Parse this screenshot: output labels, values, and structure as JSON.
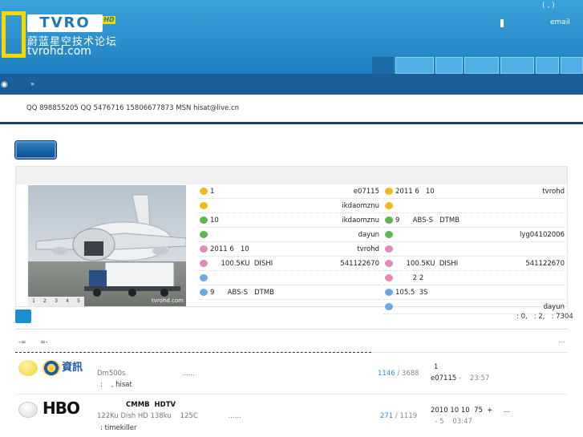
{
  "header": {
    "logo_text": "TVRO",
    "logo_badge": "HD",
    "logo_cn": "蔚蓝星空技术论坛",
    "logo_url": "tvrohd.com",
    "top_paren": "(   ,   )",
    "email_label": "email"
  },
  "subnav": {
    "bubble": "◉",
    "arrow": "»"
  },
  "contact": "QQ 898855205 QQ  5476716    15806677873 MSN hisat@live.cn",
  "panel": {
    "photo_watermark": "tvrohd.com",
    "photo_pages": [
      "1",
      "2",
      "3",
      "4",
      "5"
    ],
    "left_list": [
      {
        "icon": "yellow",
        "text": "1",
        "author": "e07115"
      },
      {
        "icon": "yellow",
        "text": "",
        "author": "ikdaomznu"
      },
      {
        "icon": "green",
        "text": "10",
        "author": "ikdaomznu"
      },
      {
        "icon": "green",
        "text": "",
        "author": "dayun"
      },
      {
        "icon": "pink",
        "text": "2011 6   10",
        "author": "tvrohd"
      },
      {
        "icon": "pink",
        "text": "     100.5KU  DISHI",
        "author": "541122670"
      },
      {
        "icon": "blue",
        "text": "",
        "author": ""
      },
      {
        "icon": "blue",
        "text": "9      ABS-S   DTMB",
        "author": ""
      }
    ],
    "right_list": [
      {
        "icon": "yellow",
        "text": "2011 6   10",
        "author": "tvrohd"
      },
      {
        "icon": "yellow",
        "text": "",
        "author": ""
      },
      {
        "icon": "green",
        "text": "9      ABS-S   DTMB",
        "author": ""
      },
      {
        "icon": "green",
        "text": "",
        "author": "lyg04102006"
      },
      {
        "icon": "pink",
        "text": "",
        "author": ""
      },
      {
        "icon": "pink",
        "text": "     100.5KU  DISHI",
        "author": "541122670"
      },
      {
        "icon": "pink",
        "text": "        2 2",
        "author": ""
      },
      {
        "icon": "blue",
        "text": "105.5  3S",
        "author": ""
      },
      {
        "icon": "blue",
        "text": "",
        "author": "dayun"
      }
    ]
  },
  "stats": ": 0,   : 2,   : 7304",
  "tabs": {
    "a": "-=",
    "b": "=-",
    "more": "..."
  },
  "forums": [
    {
      "brand": "資訊",
      "title": "",
      "desc": "Dm500s                          ......",
      "mods": ":    , hisat",
      "threads": "1146",
      "posts": " / 3688",
      "last1": "1",
      "last2_user": "e07115",
      "last2_time": " -    23:57"
    },
    {
      "brand": "HBO",
      "title": "CMMB  HDTV",
      "desc": "122Ku Dish HD 138ku    125C              ......",
      "mods": ": timekiller",
      "threads": "271",
      "posts": " / 1119",
      "last1": "2010 10 10  75  +     ...",
      "last2_user": "",
      "last2_time": "  - 5    03:47"
    }
  ]
}
